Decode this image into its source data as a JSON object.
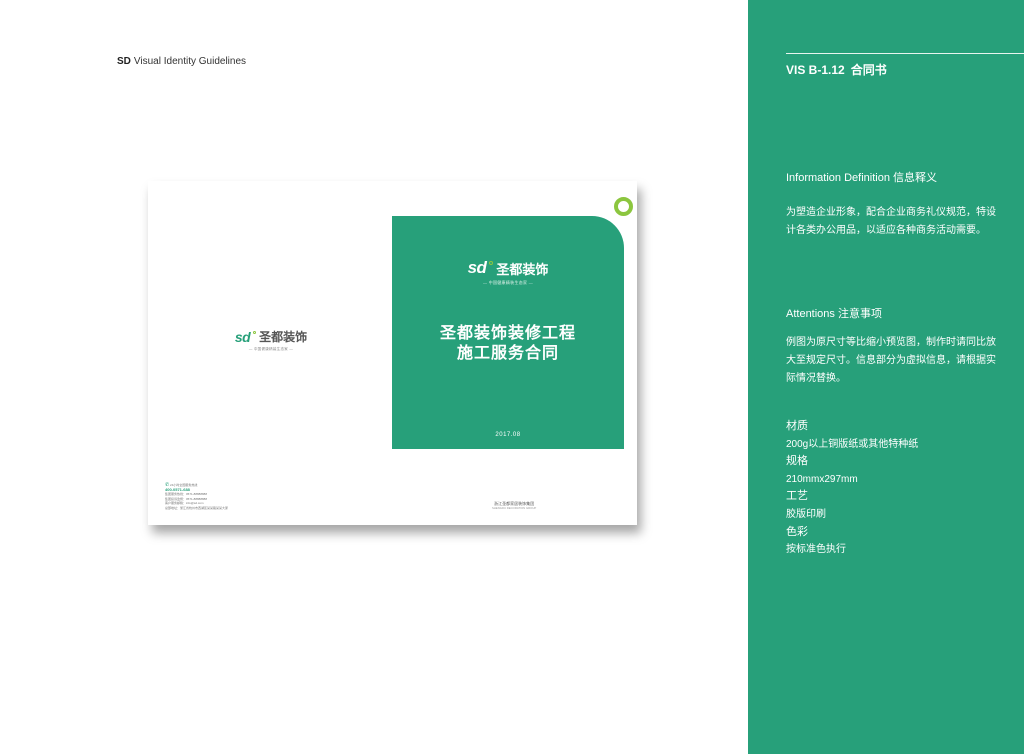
{
  "header": {
    "brand": "SD",
    "title": "Visual Identity Guidelines"
  },
  "mockup": {
    "logo_mark": "sd",
    "logo_name": "圣都装饰",
    "logo_tagline": "— 中国健康精装生态家 —",
    "cover_title_line1": "圣都装饰装修工程",
    "cover_title_line2": "施工服务合同",
    "cover_date": "2017.08",
    "contact_label": "24小时全国服务热线",
    "contact_phone": "400-0571-688",
    "contact_lines": [
      "集团服务热线：0571-88888888",
      "集团投诉监督：0571-88888888",
      "客户服务邮箱：info@sd.com",
      "总部地址：浙江省杭州市西湖区某某路某某大厦"
    ],
    "footer_company_cn": "浙江圣都家居装饰集团",
    "footer_company_en": "SHENGDU DECORATION GROUP"
  },
  "side": {
    "code": "VIS B-1.12",
    "code_title": "合同书",
    "info_heading": "Information Definition 信息释义",
    "info_text": "为塑造企业形象，配合企业商务礼仪规范，特设计各类办公用品，以适应各种商务活动需要。",
    "attention_heading": "Attentions 注意事项",
    "attention_text": "例图为原尺寸等比缩小预览图，制作时请同比放大至规定尺寸。信息部分为虚拟信息，请根据实际情况替换。",
    "specs": [
      {
        "key": "材质",
        "value": "200g以上铜版纸或其他特种纸"
      },
      {
        "key": "规格",
        "value": "210mmx297mm"
      },
      {
        "key": "工艺",
        "value": "胶版印刷"
      },
      {
        "key": "色彩",
        "value": "按标准色执行"
      }
    ]
  },
  "colors": {
    "brand_green": "#27a07a",
    "accent_lime": "#8cc63f"
  }
}
